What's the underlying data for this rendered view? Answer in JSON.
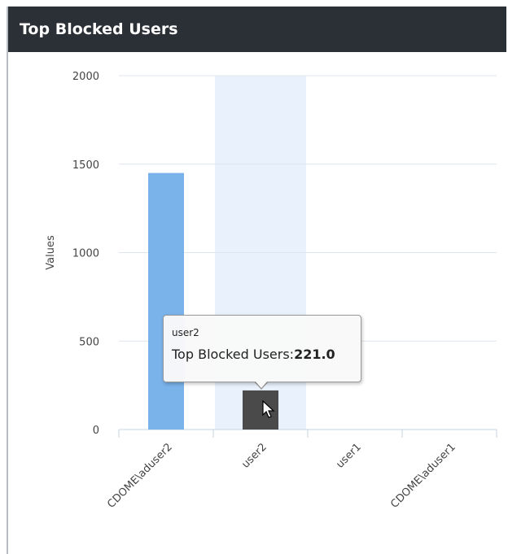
{
  "widget": {
    "title": "Top Blocked Users"
  },
  "chart_data": {
    "type": "bar",
    "title": "",
    "xlabel": "",
    "ylabel": "Values",
    "ylim": [
      0,
      2000
    ],
    "yticks": [
      0,
      500,
      1000,
      1500,
      2000
    ],
    "categories": [
      "CDOME\\aduser2",
      "user2",
      "user1",
      "CDOME\\aduser1"
    ],
    "series": [
      {
        "name": "Top Blocked Users",
        "values": [
          1450,
          221,
          0,
          0
        ]
      }
    ],
    "grid": true,
    "highlighted_category": "user2",
    "colors": {
      "bar": "#7ab3ea",
      "bar_hover": "#4a4a4a",
      "hover_band": "#e8f1fc",
      "grid": "#dfe6ee",
      "axis": "#c7d3e1",
      "text": "#444444"
    }
  },
  "tooltip": {
    "header": "user2",
    "label": "Top Blocked Users:",
    "value": "221.0"
  },
  "cursor": {
    "icon": "mouse-pointer-icon"
  }
}
